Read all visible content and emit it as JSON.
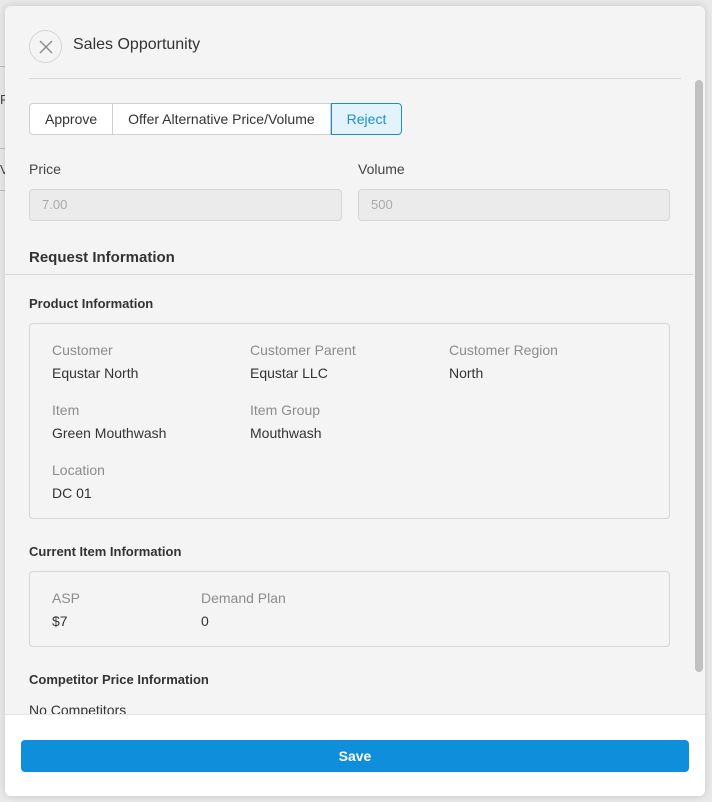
{
  "background": {
    "partial_chars": [
      "R",
      "V"
    ]
  },
  "modal": {
    "title": "Sales Opportunity",
    "close_icon": "close-icon"
  },
  "decision_tabs": [
    {
      "label": "Approve",
      "selected": false
    },
    {
      "label": "Offer Alternative Price/Volume",
      "selected": false
    },
    {
      "label": "Reject",
      "selected": true
    }
  ],
  "price": {
    "label": "Price",
    "value": "7.00",
    "disabled": true
  },
  "volume": {
    "label": "Volume",
    "value": "500",
    "disabled": true
  },
  "request_information": {
    "title": "Request Information",
    "product_information": {
      "title": "Product Information",
      "customer": {
        "label": "Customer",
        "value": "Equstar North"
      },
      "customer_parent": {
        "label": "Customer Parent",
        "value": "Equstar LLC"
      },
      "customer_region": {
        "label": "Customer Region",
        "value": "North"
      },
      "item": {
        "label": "Item",
        "value": "Green Mouthwash"
      },
      "item_group": {
        "label": "Item Group",
        "value": "Mouthwash"
      },
      "location": {
        "label": "Location",
        "value": "DC 01"
      }
    },
    "current_item_information": {
      "title": "Current Item Information",
      "asp": {
        "label": "ASP",
        "value": "$7"
      },
      "demand_plan": {
        "label": "Demand Plan",
        "value": "0"
      }
    },
    "competitor_price_information": {
      "title": "Competitor Price Information",
      "value": "No Competitors"
    }
  },
  "footer": {
    "save_label": "Save"
  },
  "colors": {
    "accent": "#0f8fdb",
    "selected_tab_bg": "#e3f3fc",
    "selected_tab_text": "#1a8fcf"
  }
}
